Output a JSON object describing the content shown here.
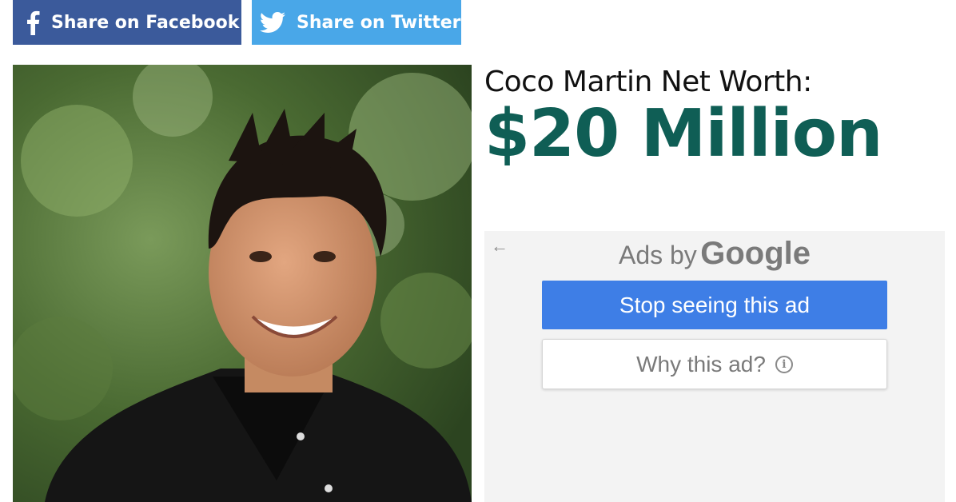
{
  "share": {
    "facebook": {
      "label": "Share on Facebook",
      "icon": "facebook-icon",
      "color": "#3b5a9b"
    },
    "twitter": {
      "label": "Share on Twitter",
      "icon": "twitter-icon",
      "color": "#49a7e8"
    }
  },
  "article": {
    "headline_label": "Coco Martin Net Worth:",
    "headline_value": "$20 Million",
    "value_color": "#0f5e55"
  },
  "ad": {
    "back_icon": "back-arrow-icon",
    "ads_by": "Ads by",
    "brand": "Google",
    "stop_label": "Stop seeing this ad",
    "why_label": "Why this ad?",
    "info_icon": "info-icon",
    "stop_color": "#3e7ee6"
  }
}
